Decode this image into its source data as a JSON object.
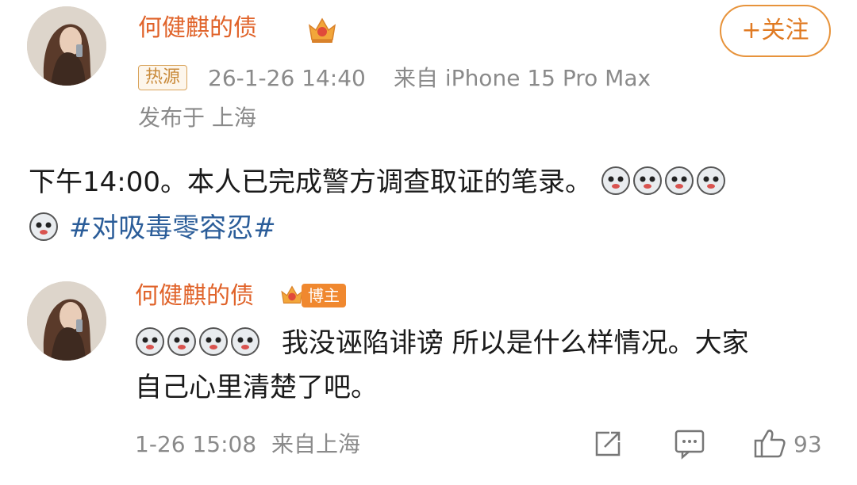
{
  "post": {
    "author": "何健麒的债",
    "follow_label": "+关注",
    "tag": "热源",
    "timestamp": "26-1-26 14:40",
    "source": "来自 iPhone 15 Pro Max",
    "location": "发布于 上海",
    "text_line1": "下午14:00。本人已完成警方调查取证的笔录。",
    "hashtag": "#对吸毒零容忍#"
  },
  "reply": {
    "author": "何健麒的债",
    "badge": "博主",
    "text_line1": "我没诬陷诽谤 所以是什么样情况。大家",
    "text_line2": "自己心里清楚了吧。",
    "timestamp": "1-26 15:08",
    "source": "来自上海",
    "like_count": "93"
  },
  "colors": {
    "name": "#e0632a",
    "hashtag": "#2b5d99",
    "meta": "#8a8a8a",
    "badge": "#f0882f"
  }
}
